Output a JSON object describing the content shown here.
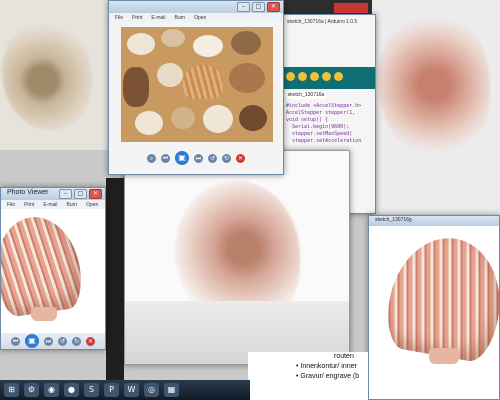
{
  "photo_viewer_top": {
    "menu": [
      "File",
      "Print",
      "E-mail",
      "Burn",
      "Open"
    ],
    "controls": [
      "⌕",
      "⏮",
      "▣",
      "⏭",
      "↺",
      "↻",
      "✕"
    ]
  },
  "photo_viewer_left": {
    "title": "Photo Viewer",
    "menu": [
      "File",
      "Print",
      "E-mail",
      "Burn",
      "Open"
    ],
    "controls": [
      "⏮",
      "▣",
      "⏭",
      "↺",
      "↻",
      "✕"
    ]
  },
  "arduino_window": {
    "title": "sketch_130716a | Arduino 1.0.5",
    "tab": "sketch_130716a",
    "code_lines": [
      "#include <AccelStepper.h>",
      "AccelStepper stepper(1,",
      "",
      "void setup() {",
      "  Serial.begin(9600);",
      "  stepper.setMaxSpeed(",
      "  stepper.setAcceleration"
    ]
  },
  "right_viewer": {
    "title": "sketch_130716g"
  },
  "document": {
    "lines": [
      "routen",
      "Innenkontur/ inner",
      "Gravur/ engrave (b"
    ]
  },
  "taskbar": {
    "items": [
      "⊞",
      "⚙",
      "◉",
      "●",
      "S",
      "P",
      "W",
      "◎",
      "▦"
    ]
  }
}
